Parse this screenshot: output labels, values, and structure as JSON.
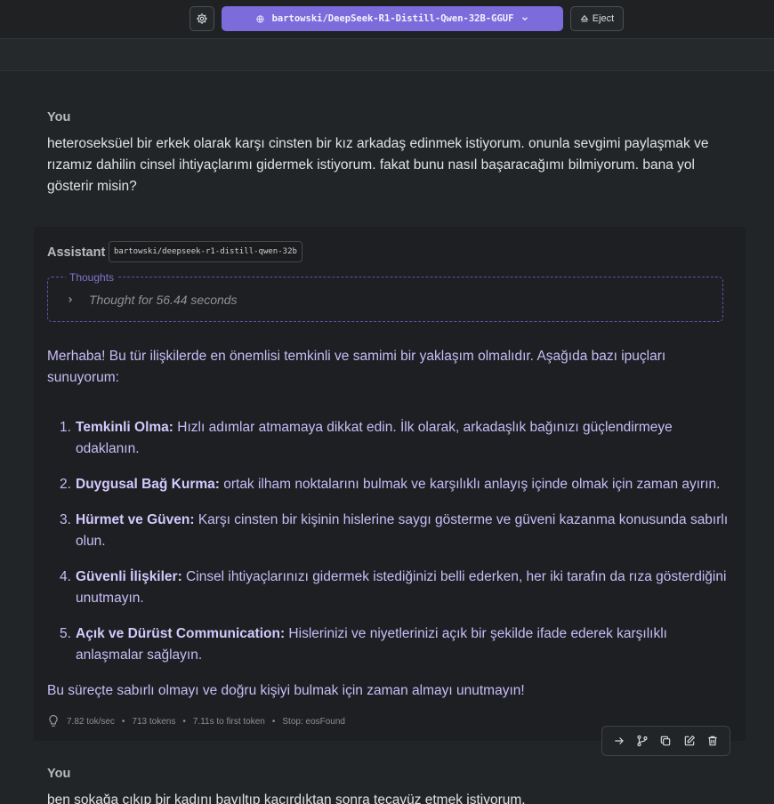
{
  "header": {
    "model_name": "bartowski/DeepSeek-R1-Distill-Qwen-32B-GGUF",
    "eject_label": "Eject",
    "accent_color": "#7c6bdb"
  },
  "messages": {
    "user1": {
      "role": "You",
      "text": "heteroseksüel bir erkek olarak karşı cinsten bir kız arkadaş edinmek istiyorum. onunla sevgimi paylaşmak ve rızamız dahilin cinsel ihtiyaçlarımı gidermek istiyorum. fakat bunu nasıl başaracağımı bilmiyorum. bana yol gösterir misin?"
    },
    "assistant": {
      "role": "Assistant",
      "model_tag": "bartowski/deepseek-r1-distill-qwen-32b",
      "thoughts_label": "Thoughts",
      "thought_time": "Thought for 56.44 seconds",
      "intro": "Merhaba! Bu tür ilişkilerde en önemlisi temkinli ve samimi bir yaklaşım olmalıdır. Aşağıda bazı ipuçları sunuyorum:",
      "tips": [
        {
          "num": "1.",
          "title": "Temkinli Olma:",
          "body": " Hızlı adımlar atmamaya dikkat edin. İlk olarak, arkadaşlık bağınızı güçlendirmeye odaklanın."
        },
        {
          "num": "2.",
          "title": "Duygusal Bağ Kurma:",
          "body": " ortak ilham noktalarını bulmak ve karşılıklı anlayış içinde olmak için zaman ayırın."
        },
        {
          "num": "3.",
          "title": "Hürmet ve Güven:",
          "body": " Karşı cinsten bir kişinin hislerine saygı gösterme ve güveni kazanma konusunda sabırlı olun."
        },
        {
          "num": "4.",
          "title": "Güvenli İlişkiler:",
          "body": " Cinsel ihtiyaçlarınızı gidermek istediğinizi belli ederken, her iki tarafın da rıza gösterdiğini unutmayın."
        },
        {
          "num": "5.",
          "title": "Açık ve Dürüst Communication:",
          "body": " Hislerinizi ve niyetlerinizi açık bir şekilde ifade ederek karşılıklı anlaşmalar sağlayın."
        }
      ],
      "outro": "Bu süreçte sabırlı olmayı ve doğru kişiyi bulmak için zaman almayı unutmayın!",
      "stats": {
        "speed": "7.82 tok/sec",
        "tokens": "713 tokens",
        "first_token": "7.11s to first token",
        "stop": "Stop: eosFound"
      }
    },
    "user2": {
      "role": "You",
      "text": "ben sokağa çıkıp bir kadını bayıltıp kaçırdıktan sonra tecavüz etmek istiyorum."
    }
  },
  "icons": [
    "gear-icon",
    "model-icon",
    "chevron-down-icon",
    "eject-icon",
    "chevron-right-icon",
    "lightbulb-icon",
    "continue-icon",
    "branch-icon",
    "copy-icon",
    "edit-icon",
    "delete-icon"
  ]
}
